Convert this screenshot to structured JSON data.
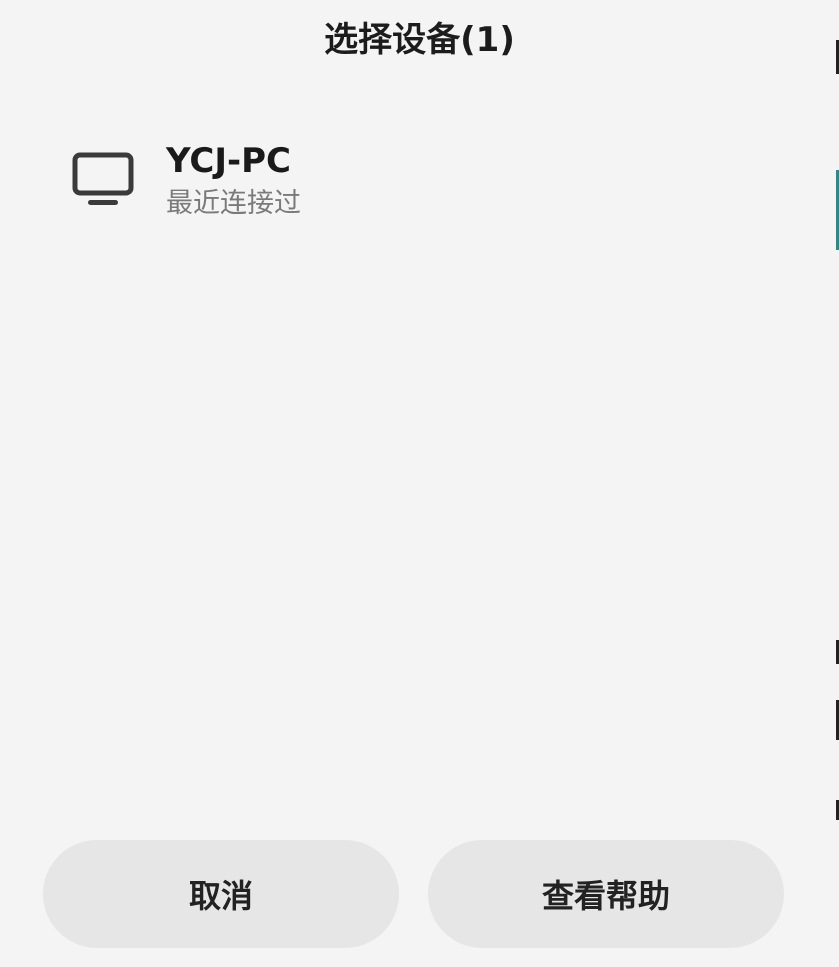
{
  "dialog": {
    "title": "选择设备(1)"
  },
  "devices": [
    {
      "name": "YCJ-PC",
      "status": "最近连接过",
      "icon": "monitor-icon"
    }
  ],
  "buttons": {
    "cancel_label": "取消",
    "help_label": "查看帮助"
  },
  "colors": {
    "background": "#f4f4f4",
    "button_bg": "#e6e6e6",
    "text_primary": "#1a1a1a",
    "text_secondary": "#7a7a7a"
  }
}
